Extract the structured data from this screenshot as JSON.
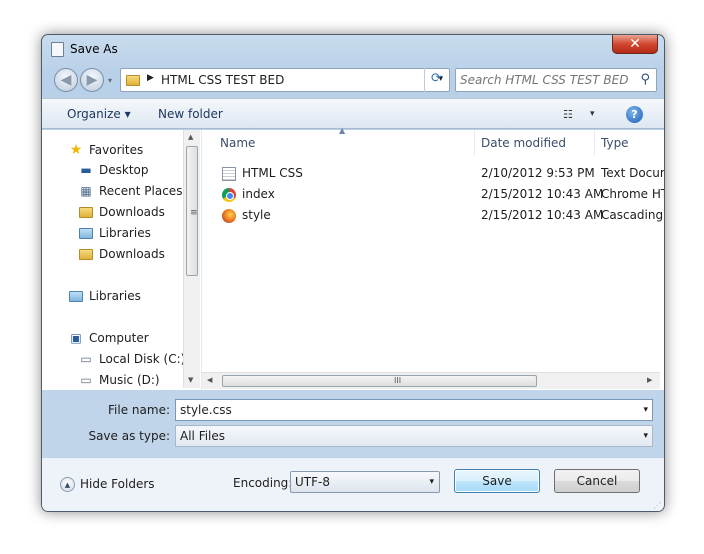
{
  "window": {
    "title": "Save As",
    "close_glyph": "✕"
  },
  "nav_buttons": {
    "back_icon": "back-arrow-icon",
    "forward_icon": "forward-arrow-icon",
    "back_glyph": "◀",
    "forward_glyph": "▶",
    "drop_glyph": "▾"
  },
  "address": {
    "chevron": "▶",
    "path": "HTML CSS TEST BED",
    "dropdown_glyph": "▾",
    "refresh_glyph": "⟳"
  },
  "search": {
    "placeholder": "Search HTML CSS TEST BED",
    "icon_glyph": "⚲"
  },
  "toolbar": {
    "organize": "Organize ▾",
    "new_folder": "New folder",
    "view_glyph": "☷",
    "view_drop": "▾",
    "help_glyph": "?"
  },
  "sidebar": {
    "items": [
      {
        "label": "Favorites",
        "icon": "star-icon",
        "glyph": "★"
      },
      {
        "label": "Desktop",
        "icon": "desktop-icon",
        "glyph": "▬"
      },
      {
        "label": "Recent Places",
        "icon": "recent-places-icon",
        "glyph": "▦"
      },
      {
        "label": "Downloads",
        "icon": "downloads-folder-icon",
        "glyph": ""
      },
      {
        "label": "Libraries",
        "icon": "libraries-icon",
        "glyph": ""
      },
      {
        "label": "Downloads",
        "icon": "downloads-folder-icon",
        "glyph": ""
      },
      {
        "label": "Libraries",
        "icon": "libraries-icon",
        "glyph": ""
      },
      {
        "label": "Computer",
        "icon": "computer-icon",
        "glyph": "▣"
      },
      {
        "label": "Local Disk (C:)",
        "icon": "hard-disk-icon",
        "glyph": "▭"
      },
      {
        "label": "Music (D:)",
        "icon": "drive-icon",
        "glyph": "▭"
      }
    ],
    "scroll_up": "▲",
    "scroll_down": "▼",
    "scroll_grip": "≡"
  },
  "columns": {
    "name": "Name",
    "date": "Date modified",
    "type": "Type",
    "sort_glyph": "▲"
  },
  "files": [
    {
      "name": "HTML CSS",
      "date": "2/10/2012 9:53 PM",
      "type": "Text Docum",
      "icon": "text-document-icon"
    },
    {
      "name": "index",
      "date": "2/15/2012 10:43 AM",
      "type": "Chrome HTI",
      "icon": "chrome-icon"
    },
    {
      "name": "style",
      "date": "2/15/2012 10:43 AM",
      "type": "Cascading",
      "icon": "firefox-icon"
    }
  ],
  "hscroll": {
    "left": "◀",
    "right": "▶",
    "grip": "III"
  },
  "form": {
    "file_name_label": "File name:",
    "file_name_value": "style.css",
    "save_type_label": "Save as type:",
    "save_type_value": "All Files",
    "dropdown_glyph": "▾"
  },
  "footer": {
    "hide_folders": "Hide Folders",
    "hide_glyph": "▲",
    "encoding_label": "Encoding:",
    "encoding_value": "UTF-8",
    "save": "Save",
    "cancel": "Cancel",
    "resize_glyph": "⋰"
  }
}
